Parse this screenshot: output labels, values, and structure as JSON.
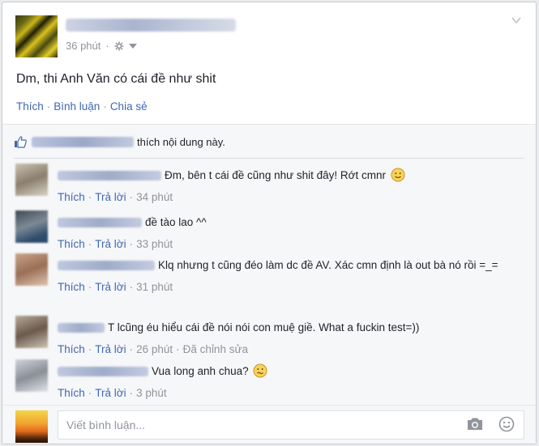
{
  "post": {
    "time": "36 phút",
    "text": "Dm, thi Anh Văn có cái đề như shit",
    "actions": [
      "Thích",
      "Bình luận",
      "Chia sẻ"
    ]
  },
  "likes": {
    "text": "thích nội dung này."
  },
  "comments": [
    {
      "text": "Đm, bên t cái đề cũng như shit đây! Rớt cmnr",
      "time": "34 phút",
      "like": "Thích",
      "reply": "Trả lời",
      "edited": "",
      "emoji": "smile"
    },
    {
      "text": "đề tào lao ^^",
      "time": "33 phút",
      "like": "Thích",
      "reply": "Trả lời",
      "edited": "",
      "emoji": ""
    },
    {
      "text": "Klq nhưng t cũng đéo làm dc đề AV. Xác cmn định là out bà nó rồi =_=",
      "time": "31 phút",
      "like": "Thích",
      "reply": "Trả lời",
      "edited": "",
      "emoji": ""
    },
    {
      "text": "T lcũng éu hiểu cái đề nói nói con muệ giề. What a fuckin test=))",
      "time": "26 phút",
      "like": "Thích",
      "reply": "Trả lời",
      "edited": "Đã chỉnh sửa",
      "emoji": ""
    },
    {
      "text": "Vua long anh chua?",
      "time": "3 phút",
      "like": "Thích",
      "reply": "Trả lời",
      "edited": "",
      "emoji": "confused"
    }
  ],
  "composer": {
    "placeholder": "Viết bình luận..."
  },
  "icons": {
    "globe": "globe-icon",
    "chevron": "chevron-down-icon",
    "like": "thumbs-up-icon",
    "camera": "camera-icon",
    "emoji": "smiley-icon"
  },
  "colors": {
    "link": "#4267b2",
    "muted": "#90949c",
    "background": "#f6f7f9"
  }
}
